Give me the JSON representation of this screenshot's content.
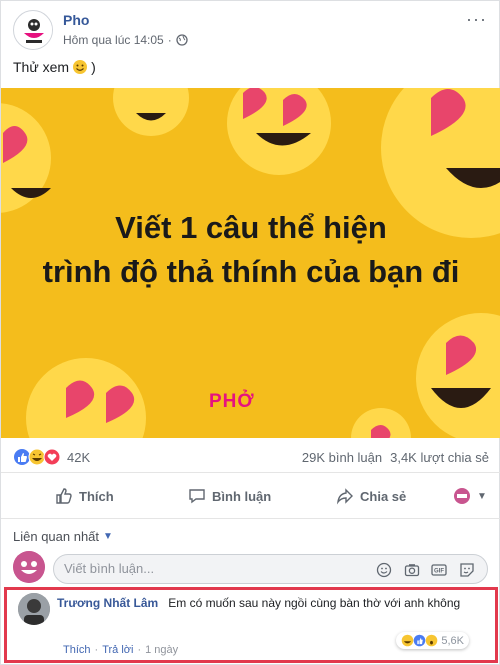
{
  "post": {
    "page_name": "Pho",
    "time": "Hôm qua lúc 14:05",
    "caption": "Thử xem",
    "caption_suffix": ")",
    "image": {
      "line1": "Viết 1 câu thể hiện",
      "line2": "trình độ thả thính của bạn đi",
      "brand": "PHỞ"
    }
  },
  "stats": {
    "reactions": "42K",
    "comments": "29K bình luận",
    "shares": "3,4K lượt chia sẻ"
  },
  "actions": {
    "like": "Thích",
    "comment": "Bình luận",
    "share": "Chia sẻ"
  },
  "sort": {
    "label": "Liên quan nhất"
  },
  "comment_box": {
    "placeholder": "Viết bình luận..."
  },
  "comment": {
    "author": "Trương Nhất Lâm",
    "text": "Em có muốn sau này ngồi cùng bàn thờ với anh không",
    "like": "Thích",
    "reply": "Trả lời",
    "age": "1 ngày",
    "reactions": "5,6K"
  },
  "colors": {
    "banner": "#f4bd1c",
    "highlight": "#e2394d",
    "link": "#385898",
    "brand": "#e6127f"
  }
}
